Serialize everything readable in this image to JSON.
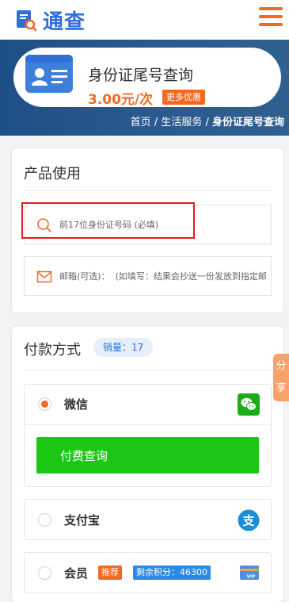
{
  "header": {
    "brand_name": "通查",
    "logo_icon": "magnifier-document-icon",
    "menu_icon": "hamburger-menu-icon",
    "accent_color": "#f26a21",
    "brand_color": "#2f6fd6"
  },
  "banner": {
    "product_icon": "id-card-icon",
    "product_title": "身份证尾号查询",
    "price": "3.00元/次",
    "promo_badge": "更多优惠",
    "breadcrumb": {
      "home": "首页",
      "sep1": " / ",
      "category": "生活服务",
      "sep2": " / ",
      "current": "身份证尾号查询"
    }
  },
  "usage": {
    "title": "产品使用",
    "id_input": {
      "icon": "search-icon",
      "placeholder": "前17位身份证号码 (必填)",
      "value": ""
    },
    "email_input": {
      "icon": "mail-icon",
      "placeholder": "邮箱(可选)：  (如填写：结果会抄送一份发放到指定邮箱)",
      "value": ""
    }
  },
  "payment": {
    "title": "付款方式",
    "sales_label": "销量：17",
    "options": [
      {
        "name": "微信",
        "icon": "wechat-icon",
        "selected": true,
        "button_label": "付费查询"
      },
      {
        "name": "支付宝",
        "icon": "alipay-icon",
        "selected": false
      },
      {
        "name": "会员",
        "icon": "vip-card-icon",
        "selected": false,
        "tag": "推荐",
        "points": "剩余积分：46300"
      }
    ]
  },
  "share": {
    "label_1": "分",
    "label_2": "享"
  }
}
